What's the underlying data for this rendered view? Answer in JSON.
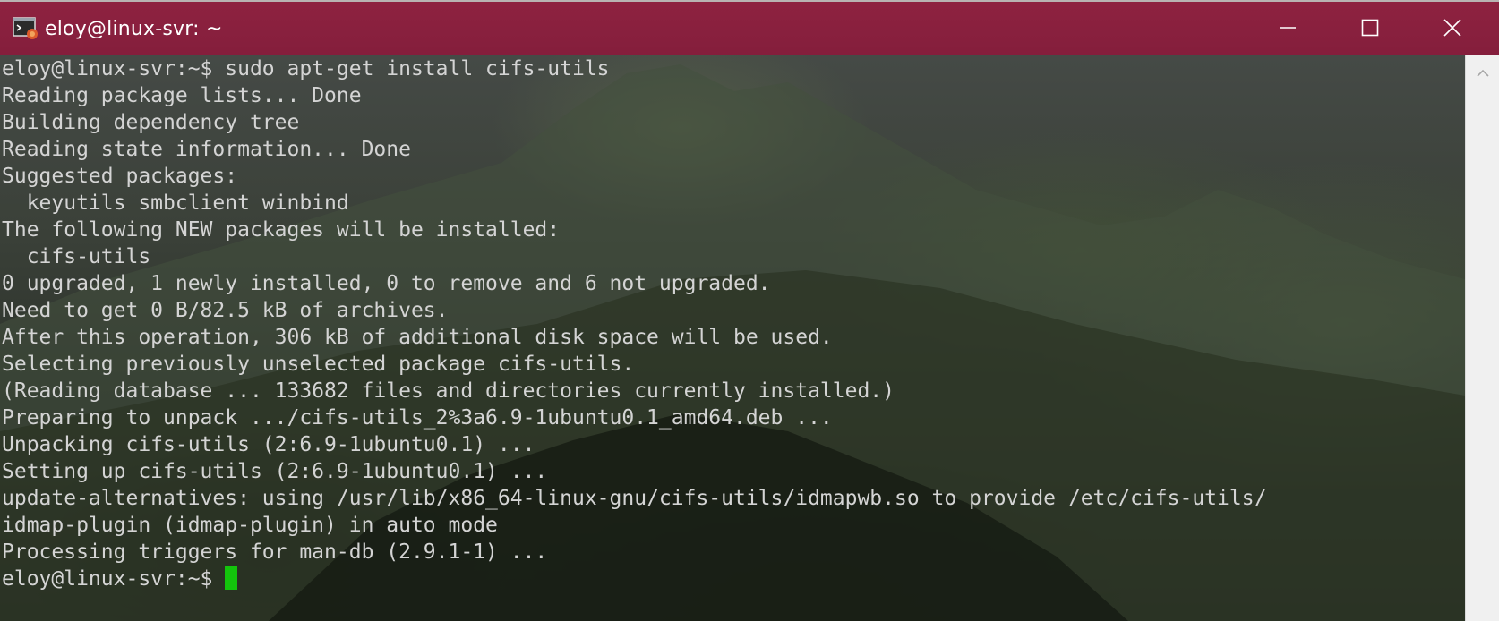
{
  "window": {
    "title": "eloy@linux-svr: ~",
    "icons": {
      "app": "terminal-app-icon",
      "minimize": "minimize-icon",
      "maximize": "maximize-icon",
      "close": "close-icon",
      "scroll_up": "chevron-up-icon"
    },
    "colors": {
      "titlebar": "#8e2240",
      "text": "#d4d4d4",
      "cursor": "#13c40c"
    }
  },
  "terminal": {
    "lines": [
      "eloy@linux-svr:~$ sudo apt-get install cifs-utils",
      "Reading package lists... Done",
      "Building dependency tree",
      "Reading state information... Done",
      "Suggested packages:",
      "  keyutils smbclient winbind",
      "The following NEW packages will be installed:",
      "  cifs-utils",
      "0 upgraded, 1 newly installed, 0 to remove and 6 not upgraded.",
      "Need to get 0 B/82.5 kB of archives.",
      "After this operation, 306 kB of additional disk space will be used.",
      "Selecting previously unselected package cifs-utils.",
      "(Reading database ... 133682 files and directories currently installed.)",
      "Preparing to unpack .../cifs-utils_2%3a6.9-1ubuntu0.1_amd64.deb ...",
      "Unpacking cifs-utils (2:6.9-1ubuntu0.1) ...",
      "Setting up cifs-utils (2:6.9-1ubuntu0.1) ...",
      "update-alternatives: using /usr/lib/x86_64-linux-gnu/cifs-utils/idmapwb.so to provide /etc/cifs-utils/",
      "idmap-plugin (idmap-plugin) in auto mode",
      "Processing triggers for man-db (2.9.1-1) ..."
    ],
    "prompt": "eloy@linux-svr:~$ "
  }
}
